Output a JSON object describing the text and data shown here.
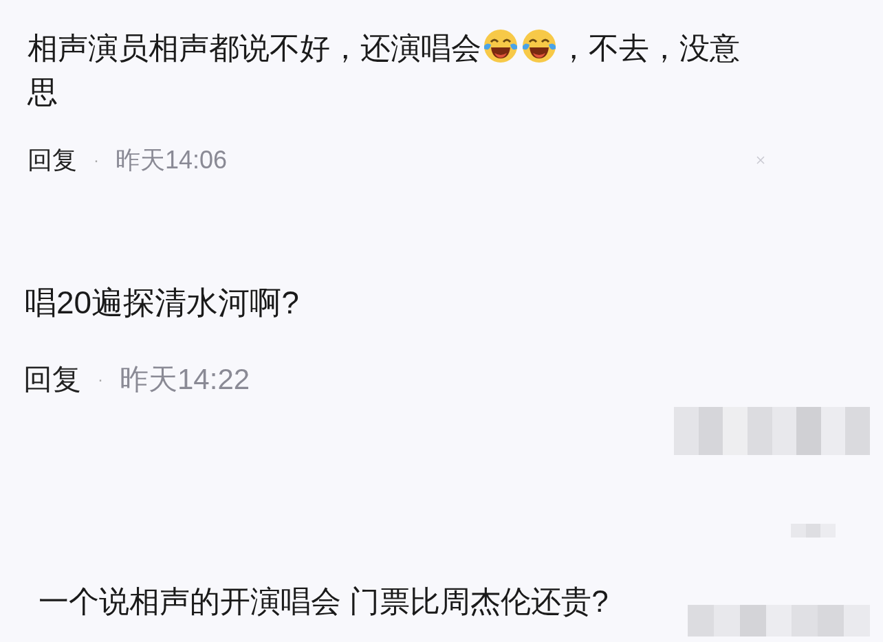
{
  "comments": [
    {
      "parts": [
        {
          "kind": "text",
          "text": "相声演员相声都说不好，还演唱会"
        },
        {
          "kind": "emoji"
        },
        {
          "kind": "emoji"
        },
        {
          "kind": "text",
          "text": "，不去，没意思"
        }
      ],
      "reply": "回复",
      "separator": "·",
      "time": "昨天14:06",
      "close": true
    },
    {
      "parts": [
        {
          "kind": "text",
          "text": "唱20遍探清水河啊?"
        }
      ],
      "reply": "回复",
      "separator": "·",
      "time": "昨天14:22"
    },
    {
      "parts": [
        {
          "kind": "text",
          "text": "一个说相声的开演唱会 门票比周杰伦还贵?"
        }
      ]
    }
  ]
}
